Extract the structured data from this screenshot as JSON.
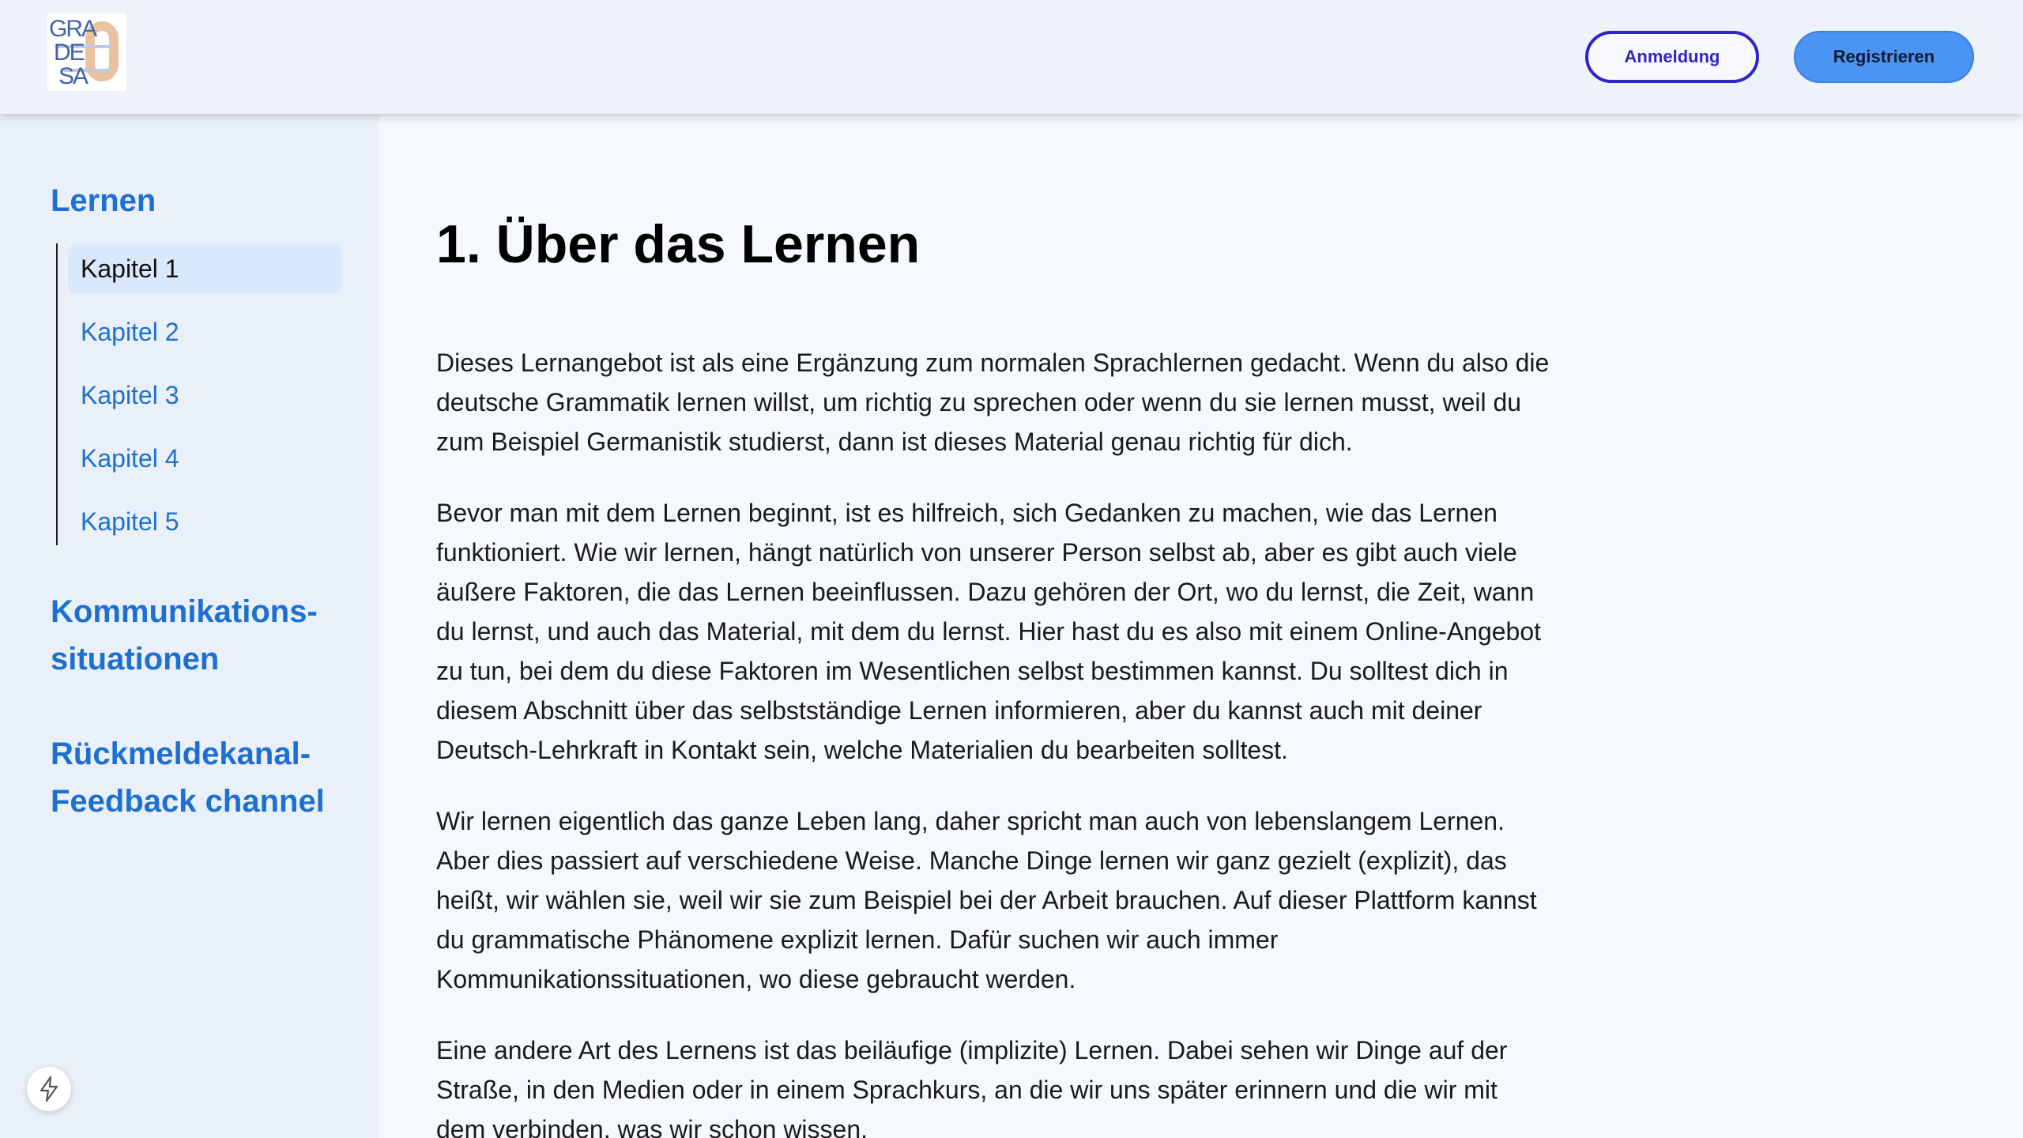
{
  "header": {
    "logo_lines": [
      "GRA",
      "DE",
      "SA"
    ],
    "logo_digit": "0",
    "login_label": "Anmeldung",
    "register_label": "Registrieren"
  },
  "sidebar": {
    "sections": [
      {
        "title": "Lernen",
        "chapters": [
          "Kapitel 1",
          "Kapitel 2",
          "Kapitel 3",
          "Kapitel 4",
          "Kapitel 5"
        ],
        "active_chapter": "Kapitel 1"
      },
      {
        "title_lines": [
          "Kommunikations-",
          "situationen"
        ]
      },
      {
        "title_lines": [
          "Rückmeldekanal-",
          "Feedback channel"
        ]
      }
    ]
  },
  "main": {
    "title": "1. Über das Lernen",
    "paragraphs": [
      "Dieses Lernangebot ist als eine Ergänzung zum normalen Sprachlernen gedacht. Wenn du also die deutsche Grammatik lernen willst, um richtig zu sprechen oder wenn du sie lernen musst, weil du zum Beispiel Germanistik studierst, dann ist dieses Material genau richtig für dich.",
      "Bevor man mit dem Lernen beginnt, ist es hilfreich, sich Gedanken zu machen, wie das Lernen funktioniert. Wie wir lernen, hängt natürlich von unserer Person selbst ab, aber es gibt auch viele äußere Faktoren, die das Lernen beeinflussen. Dazu gehören der Ort, wo du lernst, die Zeit, wann du lernst, und auch das Material, mit dem du lernst. Hier hast du es also mit einem Online-Angebot zu tun, bei dem du diese Faktoren im Wesentlichen selbst bestimmen kannst. Du solltest dich in diesem Abschnitt über das selbstständige Lernen informieren, aber du kannst auch mit deiner Deutsch-Lehrkraft in Kontakt sein, welche Materialien du bearbeiten solltest.",
      "Wir lernen eigentlich das ganze Leben lang, daher spricht man auch von lebenslangem Lernen. Aber dies passiert auf verschiedene Weise. Manche Dinge lernen wir ganz gezielt (explizit), das heißt, wir wählen sie, weil wir sie zum Beispiel bei der Arbeit brauchen. Auf dieser Plattform kannst du grammatische Phänomene explizit lernen. Dafür suchen wir auch immer Kommunikationssituationen, wo diese gebraucht werden.",
      "Eine andere Art des Lernens ist das beiläufige (implizite) Lernen. Dabei sehen wir Dinge auf der Straße, in den Medien oder in einem Sprachkurs, an die wir uns später erinnern und die wir mit dem verbinden, was wir schon wissen."
    ]
  },
  "icons": {
    "dev_indicator": "lightning-bolt-icon"
  },
  "colors": {
    "link_blue": "#1d6fd0",
    "login_border": "#3124c6",
    "register_bg": "#4b94f2",
    "sidebar_bg": "#eaf0fa",
    "active_chapter_bg": "#d9e8fb"
  }
}
